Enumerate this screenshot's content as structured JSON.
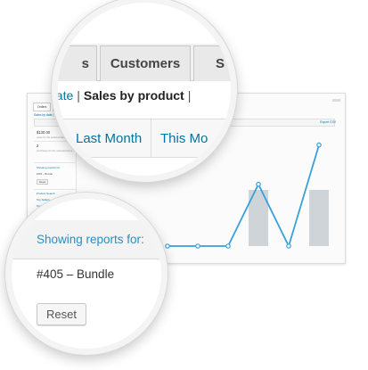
{
  "tabs": {
    "previous": "s",
    "customers": "Customers",
    "next": "S"
  },
  "subnav": {
    "by_date": "date",
    "separator": "|",
    "by_product": "Sales by product"
  },
  "ranges": {
    "last_month": "Last Month",
    "this_month": "This Mo"
  },
  "filter": {
    "showing_label": "Showing reports for:",
    "product": "#405 – Bundle",
    "reset_label": "Reset"
  },
  "mini": {
    "tab_orders": "Orders",
    "tab_customers": "Customers",
    "sub": "Sales by date | Sales by product",
    "export": "Export CSV",
    "stat_value": "$130.00",
    "stat_note": "sales for the selected items",
    "count_value": "2",
    "count_note": "purchases for the selected items",
    "showing": "Showing reports for:",
    "product": "#405 – Bundle",
    "reset": "Reset",
    "product_search": "Product Search",
    "top_sellers": "Top Sellers",
    "top_freebies": "Top Freebies"
  },
  "colors": {
    "accent": "#0074a2",
    "line": "#3aa0d8",
    "bars": "#cfd4d8"
  },
  "chart_data": {
    "type": "bar",
    "title": "",
    "series": [
      {
        "type": "bar",
        "values": [
          0,
          0,
          0,
          1,
          0,
          1
        ]
      },
      {
        "type": "line",
        "values": [
          0,
          0,
          0,
          1.1,
          0,
          1.8
        ]
      }
    ],
    "categories": [
      "",
      "",
      "",
      "",
      "",
      ""
    ],
    "ylim": [
      0,
      2
    ],
    "grid": false
  }
}
